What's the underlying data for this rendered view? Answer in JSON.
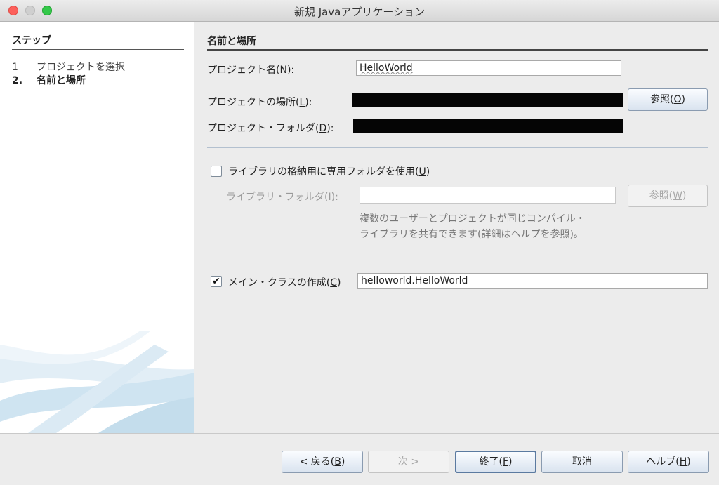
{
  "window": {
    "title": "新規 Javaアプリケーション"
  },
  "steps": {
    "heading": "ステップ",
    "items": [
      {
        "num": "1",
        "label": "プロジェクトを選択"
      },
      {
        "num": "2.",
        "label": "名前と場所"
      }
    ]
  },
  "form": {
    "section_title": "名前と場所",
    "project_name": {
      "label": "プロジェクト名(",
      "mnemonic": "N",
      "suffix": "):",
      "value": "HelloWorld"
    },
    "project_location": {
      "label": "プロジェクトの場所(",
      "mnemonic": "L",
      "suffix": "):",
      "value": ""
    },
    "project_folder": {
      "label": "プロジェクト・フォルダ(",
      "mnemonic": "D",
      "suffix": "):",
      "value": ""
    },
    "browse_button": {
      "label": "参照(",
      "mnemonic": "O",
      "suffix": ")"
    },
    "dedicated_library": {
      "label": "ライブラリの格納用に専用フォルダを使用(",
      "mnemonic": "U",
      "suffix": ")",
      "checked": false
    },
    "library_folder": {
      "label": "ライブラリ・フォルダ(",
      "mnemonic": "I",
      "suffix": "):",
      "value": ""
    },
    "library_browse_button": {
      "label": "参照(",
      "mnemonic": "W",
      "suffix": ")"
    },
    "library_help": {
      "line1": "複数のユーザーとプロジェクトが同じコンパイル・",
      "line2": "ライブラリを共有できます(詳細はヘルプを参照)。"
    },
    "main_class": {
      "label": "メイン・クラスの作成(",
      "mnemonic": "C",
      "suffix": ")",
      "checked": true,
      "value": "helloworld.HelloWorld"
    }
  },
  "buttons": {
    "back": {
      "label": "< 戻る(",
      "mnemonic": "B",
      "suffix": ")"
    },
    "next": {
      "label": "次 >"
    },
    "finish": {
      "label": "終了(",
      "mnemonic": "F",
      "suffix": ")"
    },
    "cancel": {
      "label": "取消"
    },
    "help": {
      "label": "ヘルプ(",
      "mnemonic": "H",
      "suffix": ")"
    }
  },
  "colors": {
    "accent": "#5b7aa0",
    "disabled_text": "#9a9a9a",
    "panel_bg": "#ffffff",
    "window_bg": "#ececec"
  }
}
